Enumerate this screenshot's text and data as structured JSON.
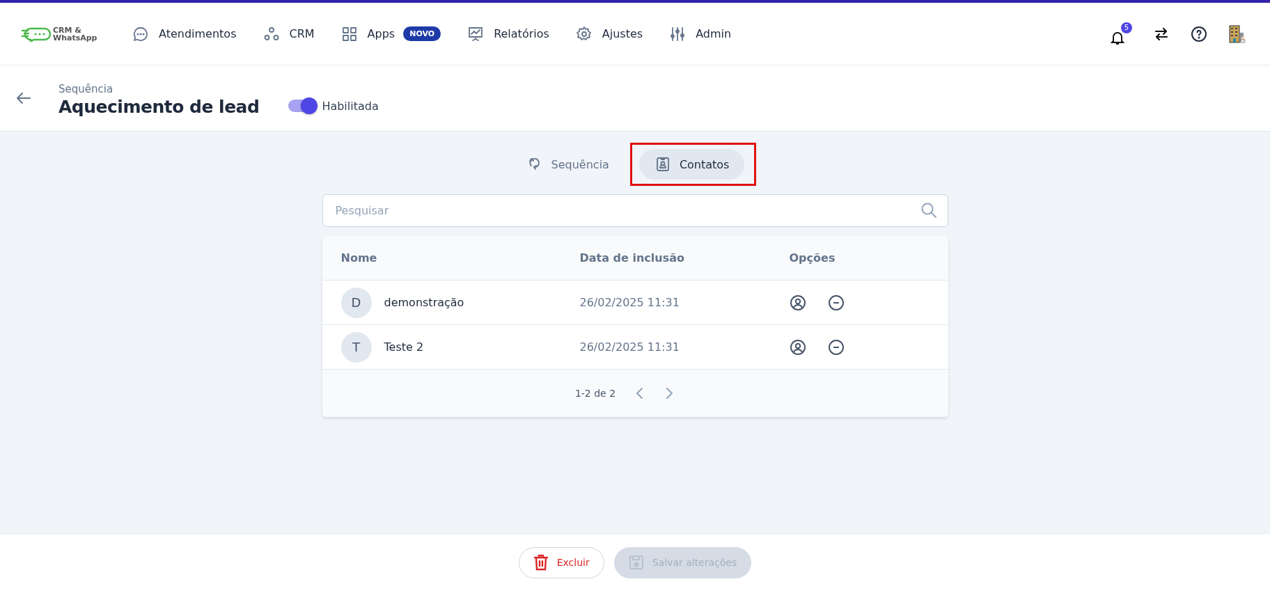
{
  "header": {
    "logo": "CRM & WhatsApp",
    "nav": [
      {
        "label": "Atendimentos"
      },
      {
        "label": "CRM"
      },
      {
        "label": "Apps",
        "badge": "NOVO"
      },
      {
        "label": "Relatórios"
      },
      {
        "label": "Ajustes"
      },
      {
        "label": "Admin"
      }
    ],
    "notification_count": "5"
  },
  "page": {
    "breadcrumb": "Sequência",
    "title": "Aquecimento de lead",
    "toggle": {
      "label": "Habilitada",
      "on": true
    }
  },
  "tabs": [
    {
      "label": "Sequência",
      "selected": false,
      "highlighted": false
    },
    {
      "label": "Contatos",
      "selected": true,
      "highlighted": true
    }
  ],
  "search": {
    "placeholder": "Pesquisar"
  },
  "table": {
    "columns": [
      "Nome",
      "Data de inclusão",
      "Opções"
    ],
    "rows": [
      {
        "initial": "D",
        "name": "demonstração",
        "date": "26/02/2025 11:31"
      },
      {
        "initial": "T",
        "name": "Teste 2",
        "date": "26/02/2025 11:31"
      }
    ],
    "pagination": "1-2 de 2"
  },
  "footer": {
    "buttons": [
      {
        "label": "Excluir",
        "kind": "danger",
        "disabled": false
      },
      {
        "label": "Salvar alterações",
        "kind": "save",
        "disabled": true
      }
    ]
  }
}
